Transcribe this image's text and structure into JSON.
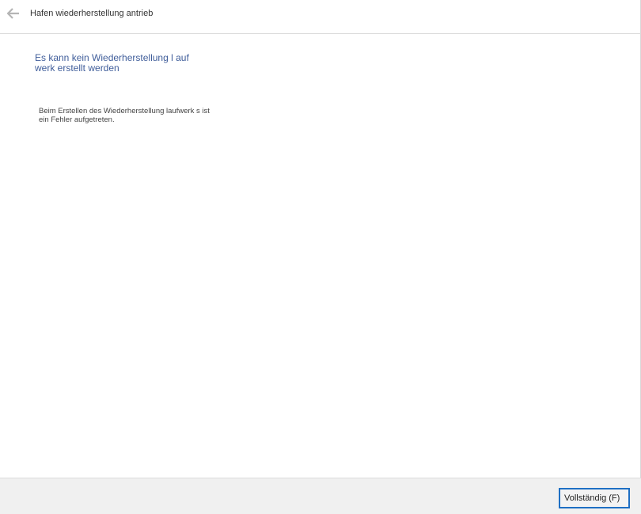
{
  "header": {
    "back_icon": "arrow-left-icon",
    "title": "Hafen wiederherstellung antrieb"
  },
  "main": {
    "heading": "Es kann kein Wiederherstellung l aufwerk erstellt werden",
    "message": "Beim Erstellen des Wiederherstellung laufwerk s ist ein Fehler aufgetreten."
  },
  "footer": {
    "finish_label": "Vollständig (F)"
  },
  "colors": {
    "heading": "#3f5d9a",
    "button_focus_border": "#1e6fc4",
    "footer_background": "#f0f0f0"
  }
}
